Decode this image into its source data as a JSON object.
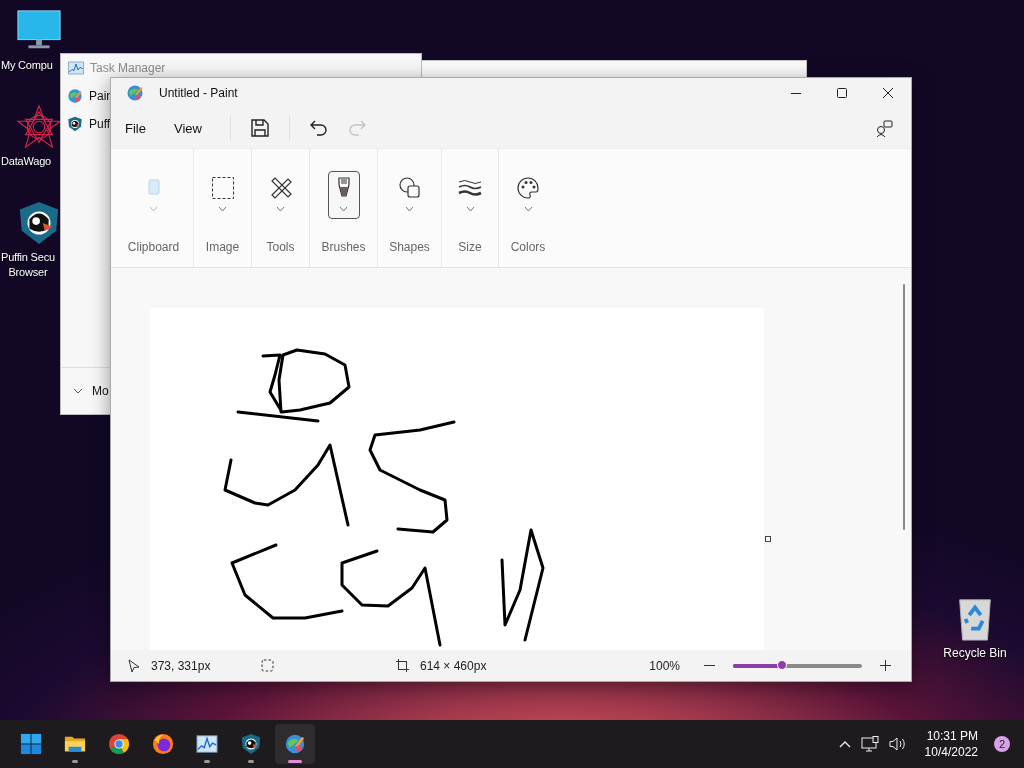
{
  "desktop": {
    "icons": [
      {
        "kind": "computer",
        "lines": [
          "My Compu"
        ]
      },
      {
        "kind": "star-app",
        "lines": [
          "DataWago"
        ]
      },
      {
        "kind": "puffin",
        "lines": [
          "Puffin Secu",
          "Browser"
        ]
      },
      {
        "kind": "recycle",
        "lines": [
          "Recycle Bin"
        ]
      }
    ]
  },
  "task_manager": {
    "title": "Task Manager",
    "processes": [
      {
        "kind": "paint",
        "label": "Pain"
      },
      {
        "kind": "puffin",
        "label": "Puff"
      }
    ],
    "footer": "Mo"
  },
  "paint": {
    "title": "Untitled - Paint",
    "menu": [
      "File",
      "View"
    ],
    "actions": [
      {
        "kind": "save",
        "disabled": false
      },
      {
        "kind": "undo",
        "disabled": false
      },
      {
        "kind": "redo",
        "disabled": true
      }
    ],
    "ribbon": [
      {
        "kind": "clipboard",
        "label": "Clipboard",
        "disabled": true,
        "selected": false
      },
      {
        "kind": "image",
        "label": "Image",
        "disabled": false,
        "selected": false
      },
      {
        "kind": "tools",
        "label": "Tools",
        "disabled": false,
        "selected": false
      },
      {
        "kind": "brushes",
        "label": "Brushes",
        "disabled": false,
        "selected": true
      },
      {
        "kind": "shapes",
        "label": "Shapes",
        "disabled": false,
        "selected": false
      },
      {
        "kind": "size",
        "label": "Size",
        "disabled": false,
        "selected": false
      },
      {
        "kind": "colors",
        "label": "Colors",
        "disabled": false,
        "selected": false
      }
    ],
    "status": {
      "cursor": "373, 331px",
      "canvas_size": "614 × 460px",
      "zoom": "100%",
      "zoom_slider": {
        "level": 0.38
      }
    }
  },
  "taskbar": {
    "apps": [
      {
        "kind": "start",
        "running": false,
        "active": false
      },
      {
        "kind": "explorer",
        "running": true,
        "active": false
      },
      {
        "kind": "chrome",
        "running": false,
        "active": false
      },
      {
        "kind": "firefox",
        "running": false,
        "active": false
      },
      {
        "kind": "taskmgr",
        "running": true,
        "active": false
      },
      {
        "kind": "puffin",
        "running": true,
        "active": false
      },
      {
        "kind": "paint",
        "running": true,
        "active": true
      }
    ],
    "time": "10:31 PM",
    "date": "10/4/2022",
    "notifications": "2"
  }
}
